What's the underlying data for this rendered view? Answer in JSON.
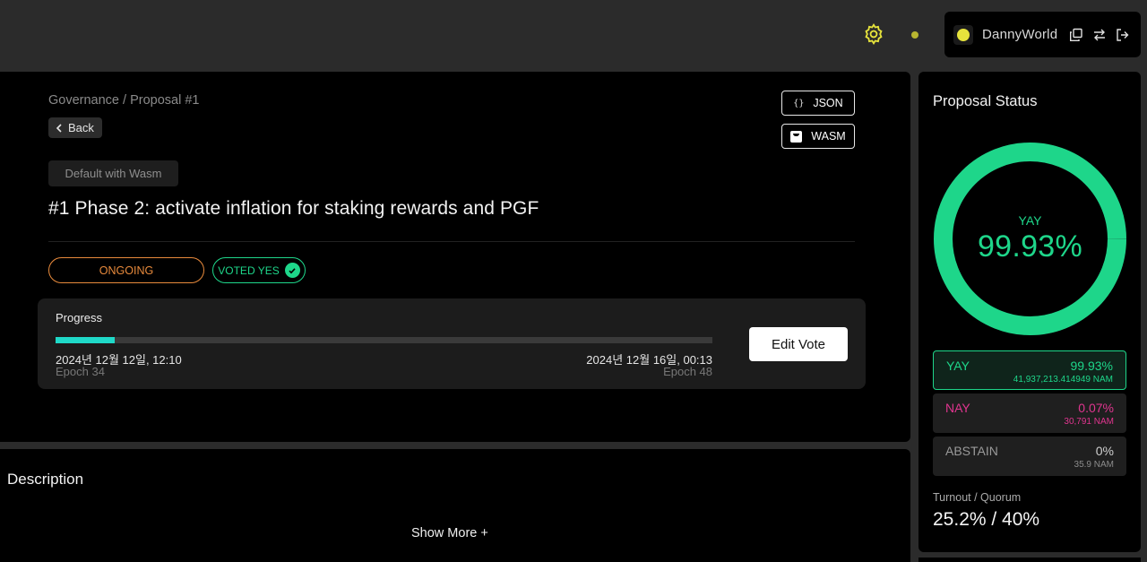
{
  "header": {
    "account_name": "DannyWorld",
    "icons": [
      "gear-icon",
      "status-dot",
      "copy-icon",
      "switch-icon",
      "logout-icon"
    ]
  },
  "proposal": {
    "breadcrumb": "Governance / Proposal #1",
    "back_label": "Back",
    "json_label": "JSON",
    "wasm_label": "WASM",
    "tag": "Default with Wasm",
    "title": "#1 Phase 2: activate inflation for staking rewards and PGF",
    "status_pill": "ONGOING",
    "voted_pill": "VOTED YES",
    "progress": {
      "label": "Progress",
      "fraction": 0.09,
      "start_date": "2024년 12월 12일, 12:10",
      "start_epoch": "Epoch 34",
      "end_date": "2024년 12월 16일, 00:13",
      "end_epoch": "Epoch 48"
    },
    "edit_vote_label": "Edit Vote"
  },
  "description": {
    "title": "Description",
    "show_more": "Show More +"
  },
  "status": {
    "title": "Proposal Status",
    "donut_label": "YAY",
    "donut_value": "99.93%",
    "yay_fraction": 0.9993,
    "rows": [
      {
        "label": "YAY",
        "pct": "99.93%",
        "amount": "41,937,213.414949 NAM"
      },
      {
        "label": "NAY",
        "pct": "0.07%",
        "amount": "30,791 NAM"
      },
      {
        "label": "ABSTAIN",
        "pct": "0%",
        "amount": "35.9 NAM"
      }
    ],
    "turnout_label": "Turnout / Quorum",
    "turnout_value": "25.2% / 40%"
  },
  "colors": {
    "yay": "#1ed68a",
    "nay": "#e0358f",
    "ongoing": "#e88a3c",
    "progress": "#1fd9c8",
    "accent_yellow": "#e6e33c"
  }
}
